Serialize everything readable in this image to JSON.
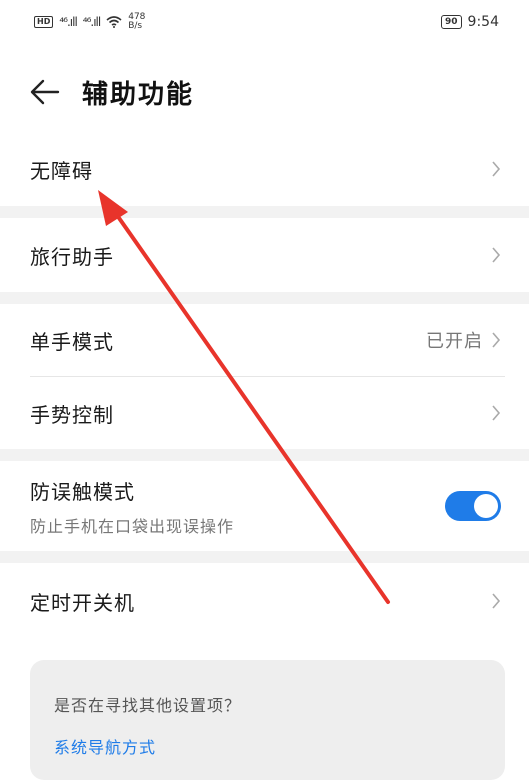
{
  "status_bar": {
    "hd": "HD",
    "hd_sub": "D",
    "signal1": "⁴⁶.ıll",
    "signal2": "⁴⁶.ıll",
    "speed_value": "478",
    "speed_unit": "B/s",
    "battery": "90",
    "time": "9:54"
  },
  "header": {
    "title": "辅助功能"
  },
  "items": [
    {
      "label": "无障碍"
    },
    {
      "label": "旅行助手"
    },
    {
      "label": "单手模式",
      "value": "已开启"
    },
    {
      "label": "手势控制"
    },
    {
      "label": "防误触模式",
      "sublabel": "防止手机在口袋出现误操作",
      "toggle_on": true
    },
    {
      "label": "定时开关机"
    }
  ],
  "suggestion": {
    "question": "是否在寻找其他设置项？",
    "link": "系统导航方式"
  },
  "colors": {
    "accent": "#1f7ce8",
    "annotation_arrow": "#e8342b"
  }
}
